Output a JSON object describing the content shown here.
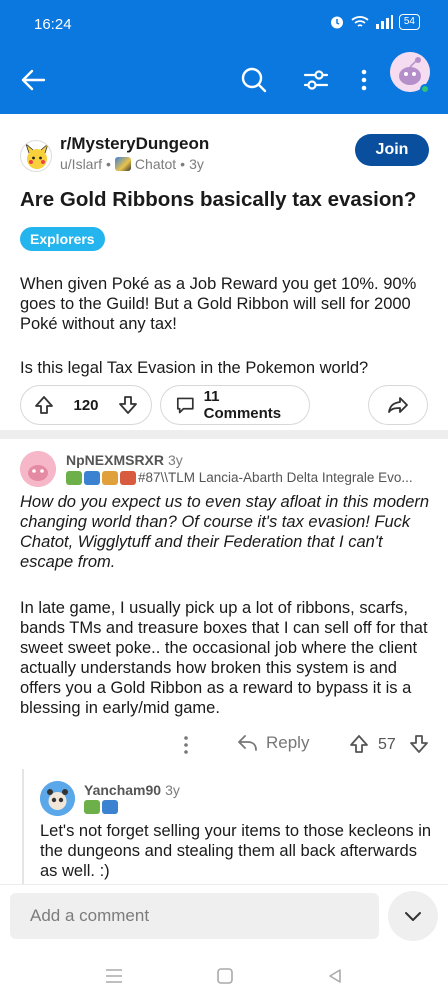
{
  "status_bar": {
    "time": "16:24",
    "battery": "54"
  },
  "nav": {
    "back_icon": "arrow-left-icon",
    "search_icon": "search-icon",
    "filter_icon": "filter-icon",
    "more_icon": "more-vertical-icon"
  },
  "post": {
    "subreddit": "r/MysteryDungeon",
    "author": "u/Islarf",
    "author_flair": "Chatot",
    "age": "3y",
    "join_label": "Join",
    "title": "Are Gold Ribbons basically tax evasion?",
    "flair": "Explorers",
    "body_p1": "When given Poké as a Job Reward you get 10%. 90% goes to the Guild! But a Gold Ribbon will sell for 2000 Poké without any tax!",
    "body_p2": "Is this legal Tax Evasion in the Pokemon world?",
    "votes": "120",
    "comments_label": "11 Comments"
  },
  "comments": [
    {
      "user": "NpNEXMSRXR",
      "age": "3y",
      "flair": "#87\\\\TLM Lancia-Abarth Delta Integrale Evo...",
      "italic_text": "How do you expect us to even stay afloat in this modern changing world than? Of course it's tax evasion! Fuck Chatot, Wigglytuff and their Federation that I can't escape from.",
      "text": "In late game, I usually pick up a lot of ribbons, scarfs, bands TMs and treasure boxes that I can sell off for that sweet sweet poke.. the occasional job where the client actually understands how broken this system is and offers you a Gold Ribbon as a reward to bypass it is a blessing in early/mid game.",
      "reply_label": "Reply",
      "score": "57"
    },
    {
      "user": "Yancham90",
      "age": "3y",
      "text": "Let's not forget selling your items to those kecleons in the dungeons and stealing them all back afterwards as well. :)"
    }
  ],
  "composer": {
    "placeholder": "Add a comment"
  },
  "colors": {
    "header": "#0b78df",
    "join": "#0a4f9e",
    "flair": "#24b5ee"
  }
}
